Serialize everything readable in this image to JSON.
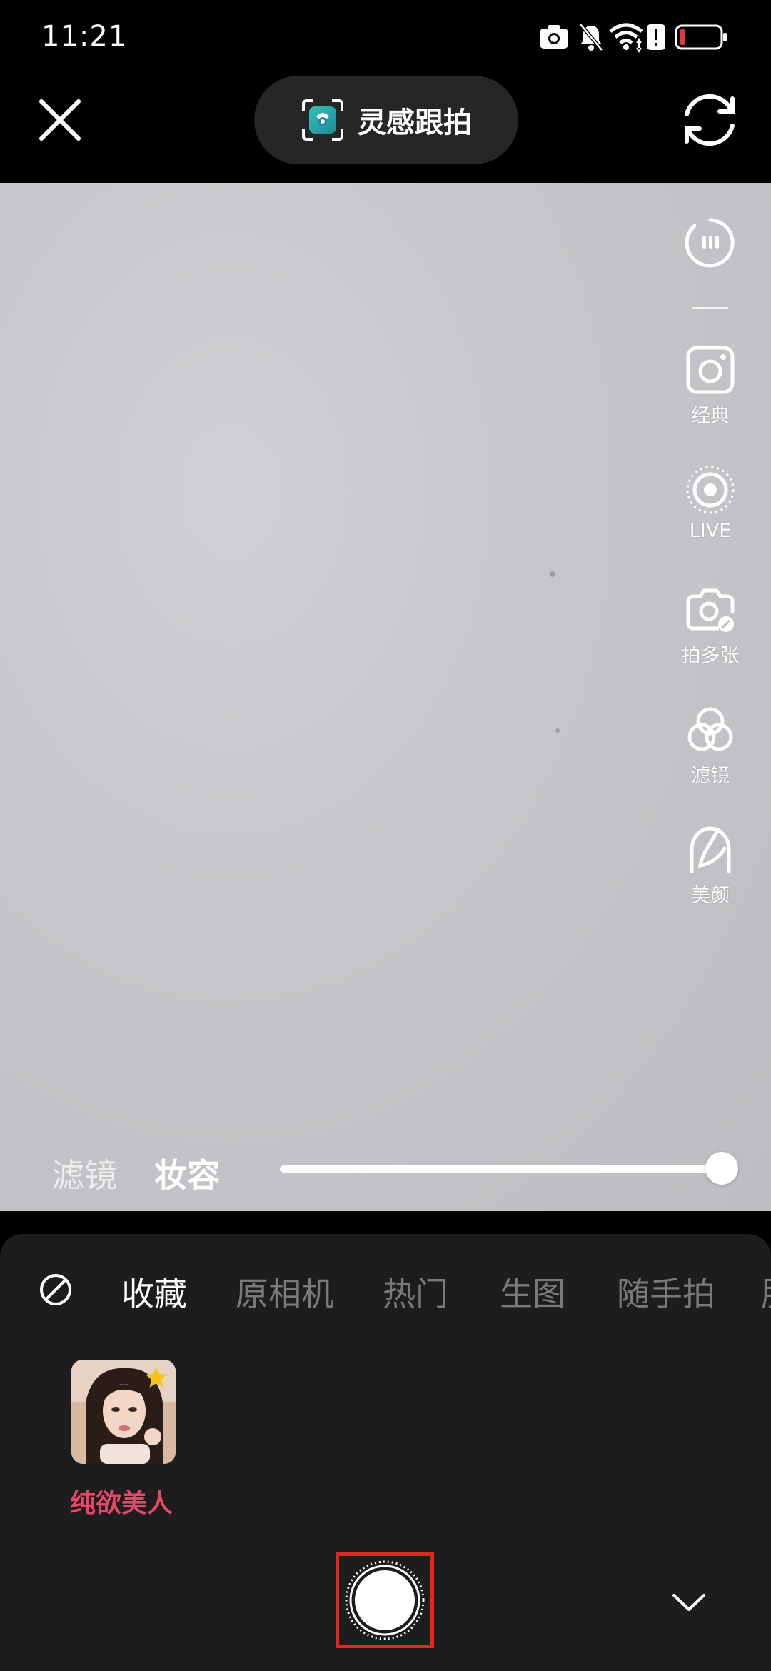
{
  "status_bar": {
    "time": "11:21",
    "icons": [
      "camera-icon",
      "mute-icon",
      "wifi-icon",
      "alert-icon",
      "battery-icon"
    ]
  },
  "top_bar": {
    "title": "灵感跟拍",
    "close_icon": "close-icon",
    "flip_icon": "camera-flip-icon"
  },
  "toolbar": {
    "items": [
      {
        "icon": "more-icon",
        "label": ""
      },
      {
        "icon": "classic-frame-icon",
        "label": "经典"
      },
      {
        "icon": "live-icon",
        "label": "LIVE"
      },
      {
        "icon": "multi-shot-icon",
        "label": "拍多张"
      },
      {
        "icon": "filter-icon",
        "label": "滤镜"
      },
      {
        "icon": "beauty-icon",
        "label": "美颜"
      }
    ]
  },
  "adjust": {
    "tabs": [
      "滤镜",
      "妆容"
    ],
    "active_tab": "妆容",
    "slider_level_percent": 100
  },
  "categories": {
    "items": [
      "收藏",
      "原相机",
      "热门",
      "生图",
      "随手拍",
      "肤"
    ],
    "active": "收藏"
  },
  "styles": [
    {
      "label": "纯欲美人",
      "favorited": true
    }
  ],
  "colors": {
    "accent_pink": "#e9466a",
    "highlight_red": "#e8241b",
    "battery_red": "#e53935"
  }
}
